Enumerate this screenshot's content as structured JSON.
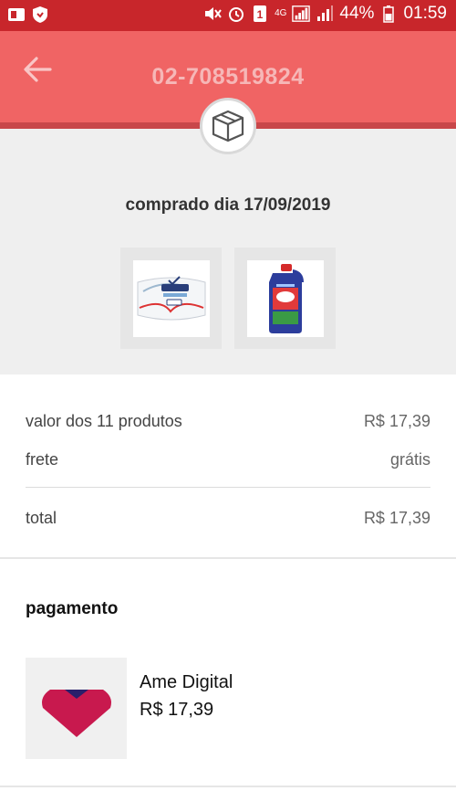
{
  "status_bar": {
    "network": "4G",
    "battery": "44%",
    "time": "01:59",
    "sim_slot": "1",
    "background_color": "#c8262b"
  },
  "header": {
    "order_number": "02-708519824",
    "background_color": "#f06464",
    "back_icon": "arrow-left-icon",
    "badge_icon": "box-icon"
  },
  "summary": {
    "purchase_date": "comprado dia 17/09/2019",
    "products": [
      {
        "name": "Rexona soap",
        "icon": "soap-product-image"
      },
      {
        "name": "Omo detergent bottle",
        "icon": "detergent-product-image"
      }
    ]
  },
  "values": {
    "products_label": "valor dos 11 produtos",
    "products_value": "R$ 17,39",
    "shipping_label": "frete",
    "shipping_value": "grátis",
    "total_label": "total",
    "total_value": "R$ 17,39"
  },
  "payment": {
    "heading": "pagamento",
    "method": "Ame Digital",
    "amount": "R$ 17,39",
    "logo_icon": "ame-digital-logo",
    "logo_color": "#c8194e"
  }
}
